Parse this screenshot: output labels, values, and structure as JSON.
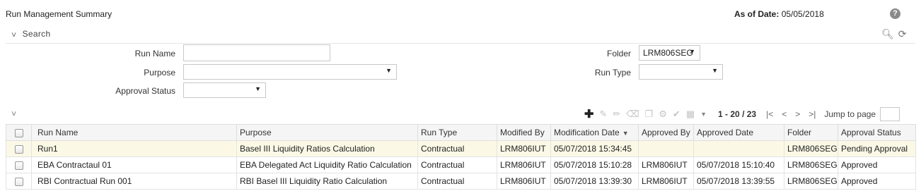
{
  "page": {
    "title": "Run Management Summary",
    "as_of_label": "As of Date:",
    "as_of_value": "05/05/2018"
  },
  "icons": {
    "help": "help-icon",
    "search": "search-icon",
    "reset": "refresh-icon"
  },
  "search": {
    "header": "Search",
    "fields": {
      "run_name_label": "Run Name",
      "run_name_value": "",
      "purpose_label": "Purpose",
      "purpose_value": "",
      "approval_status_label": "Approval Status",
      "approval_status_value": "",
      "folder_label": "Folder",
      "folder_value": "LRM806SEG",
      "run_type_label": "Run Type",
      "run_type_value": ""
    }
  },
  "toolbar": {
    "add": "add-icon",
    "pager_text": "1 - 20 / 23",
    "jump_label": "Jump to page",
    "jump_value": ""
  },
  "grid": {
    "columns": [
      "Run Name",
      "Purpose",
      "Run Type",
      "Modified By",
      "Modification Date",
      "Approved By",
      "Approved Date",
      "Folder",
      "Approval Status"
    ],
    "sorted_column": "Modification Date",
    "rows": [
      {
        "run_name": "Run1",
        "purpose": "Basel III Liquidity Ratios Calculation",
        "run_type": "Contractual",
        "modified_by": "LRM806IUT",
        "modification_date": "05/07/2018 15:34:45",
        "approved_by": "",
        "approved_date": "",
        "folder": "LRM806SEG",
        "approval_status": "Pending Approval"
      },
      {
        "run_name": "EBA Contractaul 01",
        "purpose": "EBA Delegated Act Liquidity Ratio Calculation",
        "run_type": "Contractual",
        "modified_by": "LRM806IUT",
        "modification_date": "05/07/2018 15:10:28",
        "approved_by": "LRM806IUT",
        "approved_date": "05/07/2018 15:10:40",
        "folder": "LRM806SEG",
        "approval_status": "Approved"
      },
      {
        "run_name": "RBI Contractual Run 001",
        "purpose": "RBI Basel III Liquidity Ratio Calculation",
        "run_type": "Contractual",
        "modified_by": "LRM806IUT",
        "modification_date": "05/07/2018 13:39:30",
        "approved_by": "LRM806IUT",
        "approved_date": "05/07/2018 13:39:55",
        "folder": "LRM806SEG",
        "approval_status": "Approved"
      }
    ]
  }
}
